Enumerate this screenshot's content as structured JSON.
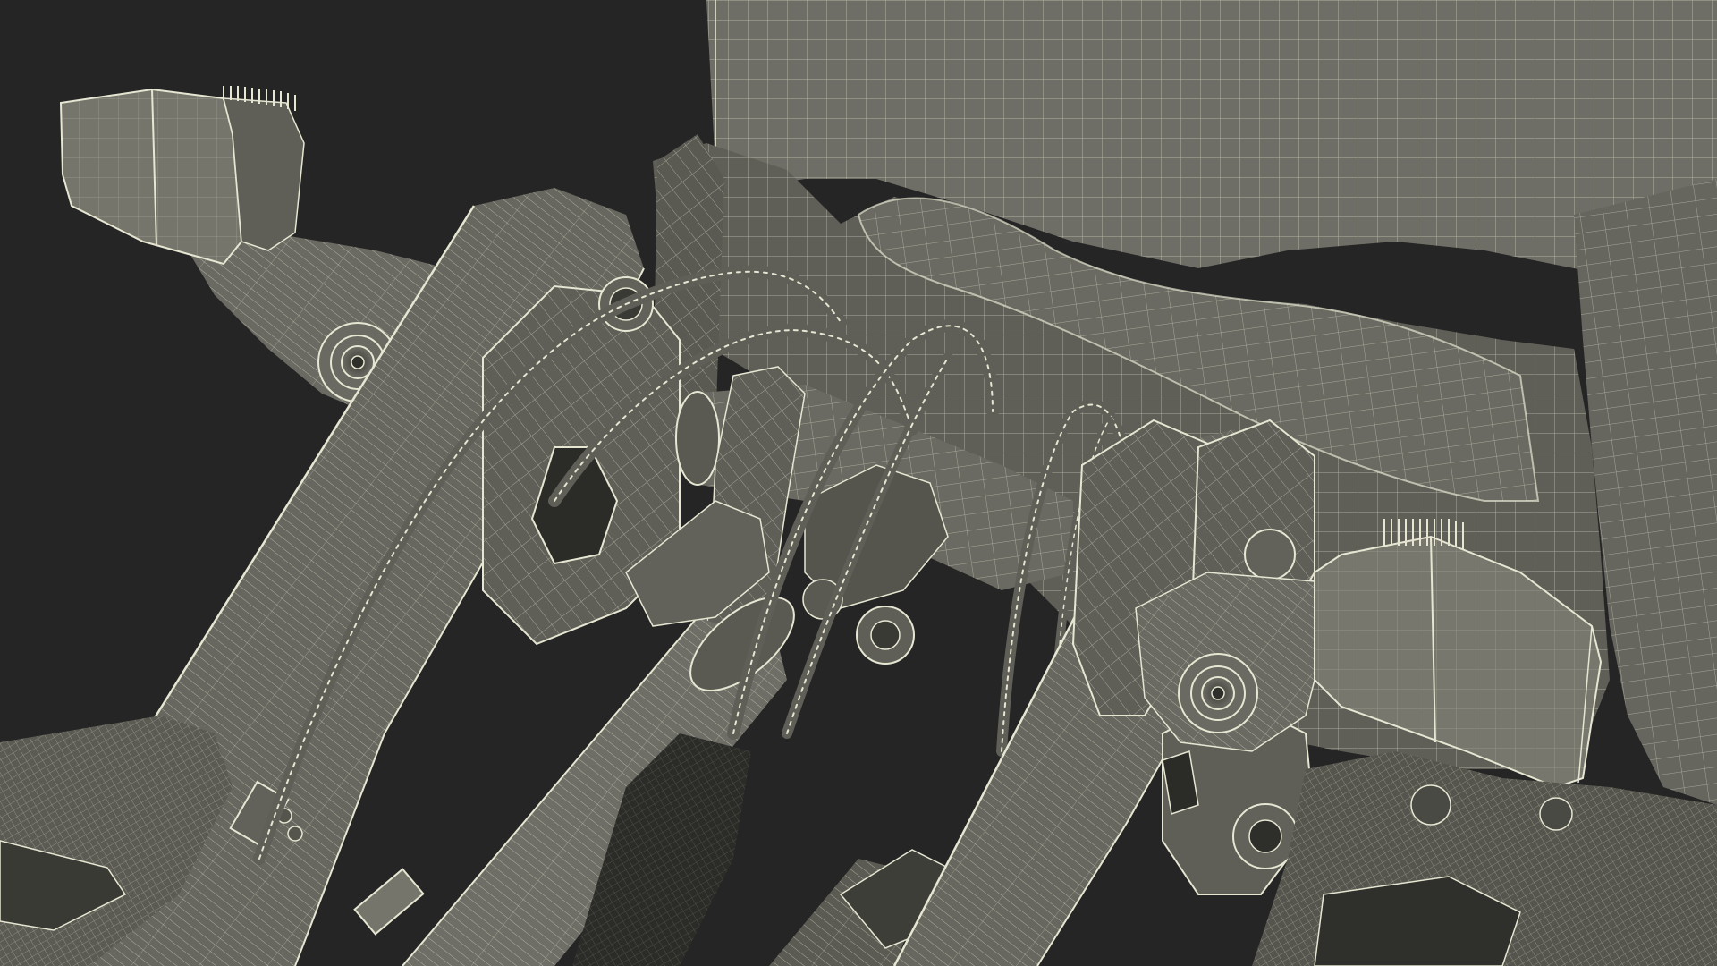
{
  "scene": {
    "subject": "wireframe-render",
    "background_color": "#252525",
    "surface_color": "#6e6e66",
    "surface_dark": "#55554e",
    "surface_shadow": "#3e3e39",
    "surface_light": "#86867d",
    "wire_color": "#e6e6d2"
  }
}
